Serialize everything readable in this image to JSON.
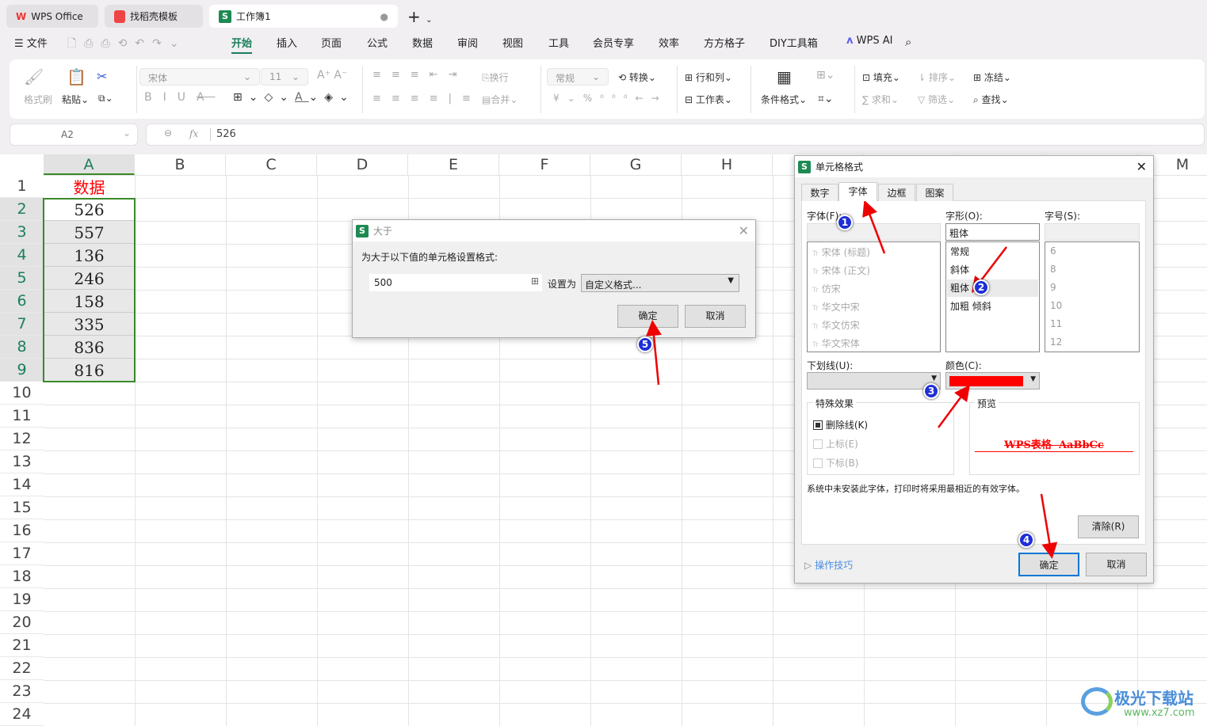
{
  "tabs": [
    {
      "label": "WPS Office"
    },
    {
      "label": "找稻壳模板"
    },
    {
      "label": "工作簿1"
    }
  ],
  "menu": {
    "file": "文件",
    "items": [
      "开始",
      "插入",
      "页面",
      "公式",
      "数据",
      "审阅",
      "视图",
      "工具",
      "会员专享",
      "效率",
      "方方格子",
      "DIY工具箱"
    ],
    "ai": "WPS AI",
    "active": "开始"
  },
  "ribbon": {
    "format_painter": "格式刷",
    "paste": "粘贴",
    "font": "宋体",
    "size": "11",
    "wrap": "换行",
    "merge": "合并",
    "number_format": "常规",
    "convert": "转换",
    "row_col": "行和列",
    "sheet": "工作表",
    "cond_format": "条件格式",
    "fill": "填充",
    "sort": "排序",
    "freeze": "冻结",
    "sum": "求和",
    "filter": "筛选",
    "find": "查找"
  },
  "formula_bar": {
    "cell_ref": "A2",
    "fx": "fx",
    "value": "526"
  },
  "grid": {
    "columns": [
      "A",
      "B",
      "C",
      "D",
      "E",
      "F",
      "G",
      "H",
      "I",
      "J",
      "K",
      "L",
      "M"
    ],
    "rows": 24,
    "header": "数据",
    "values": [
      "526",
      "557",
      "136",
      "246",
      "158",
      "335",
      "836",
      "816"
    ]
  },
  "dialog_gt": {
    "title": "大于",
    "prompt": "为大于以下值的单元格设置格式:",
    "value": "500",
    "set_as": "设置为",
    "format": "自定义格式...",
    "ok": "确定",
    "cancel": "取消"
  },
  "dialog_fmt": {
    "title": "单元格格式",
    "tabs": [
      "数字",
      "字体",
      "边框",
      "图案"
    ],
    "active_tab": "字体",
    "font_label": "字体(F):",
    "fonts": [
      "宋体 (标题)",
      "宋体 (正文)",
      "仿宋",
      "华文中宋",
      "华文仿宋",
      "华文宋体"
    ],
    "style_label": "字形(O):",
    "style_value": "粗体",
    "styles": [
      "常规",
      "斜体",
      "粗体",
      "加粗 倾斜"
    ],
    "size_label": "字号(S):",
    "sizes": [
      "6",
      "8",
      "9",
      "10",
      "11",
      "12"
    ],
    "underline_label": "下划线(U):",
    "color_label": "颜色(C):",
    "color": "#ff0000",
    "effects_label": "特殊效果",
    "strike": "删除线(K)",
    "sup": "上标(E)",
    "sub": "下标(B)",
    "preview_label": "预览",
    "preview_text": "WPS表格  AaBbCc",
    "note": "系统中未安装此字体，打印时将采用最相近的有效字体。",
    "clear": "清除(R)",
    "tips": "操作技巧",
    "ok": "确定",
    "cancel": "取消"
  },
  "steps": [
    "1",
    "2",
    "3",
    "4",
    "5"
  ],
  "watermark": {
    "name": "极光下载站",
    "url": "www.xz7.com"
  }
}
